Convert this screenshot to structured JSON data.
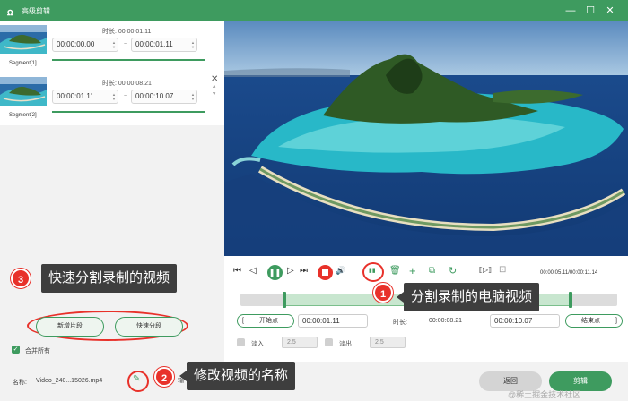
{
  "window": {
    "title": "高级剪辑",
    "logo_glyph": "ꭥ",
    "accent_color": "#3e9b5f",
    "controls": {
      "minimize": "—",
      "maximize": "☐",
      "close": "✕"
    }
  },
  "segments": [
    {
      "label": "Segment[1]",
      "duration_label": "时长: 00:00:01.11",
      "start": "00:00:00.00",
      "end": "00:00:01.11"
    },
    {
      "label": "Segment[2]",
      "duration_label": "时长: 00:00:08.21",
      "start": "00:00:01.11",
      "end": "00:00:10.07"
    }
  ],
  "segment_controls": {
    "close_glyph": "✕",
    "up_glyph": "˄",
    "down_glyph": "˅",
    "spin_up": "▲",
    "spin_down": "▼",
    "range_sep": "~"
  },
  "left_actions": {
    "new_segment": "新增片段",
    "quick_split": "快速分段",
    "merge_all": "合并所有",
    "check_glyph": "✓"
  },
  "output": {
    "name_label": "名称:",
    "filename": "Video_240...15026.mp4",
    "output_label_partial": "输"
  },
  "callouts": [
    {
      "number": "3",
      "text": "快速分割录制的视频"
    },
    {
      "number": "1",
      "text": "分割录制的电脑视频"
    },
    {
      "number": "2",
      "text": "修改视频的名称"
    }
  ],
  "player": {
    "time_display": "00:00:05.11/00:00:11.14",
    "icons": {
      "prev_frame": "⏮",
      "step_back": "◁",
      "play_pause": "❚❚",
      "step_forward": "▷",
      "next_frame": "⏭",
      "volume": "🔊",
      "split": "▮▮",
      "delete": "🗑",
      "add": "+",
      "copy": "⧉",
      "reset": "↻",
      "crop": "⟦▷⟧",
      "fit": "⊡"
    }
  },
  "clip": {
    "start_button": "开始点",
    "start_time": "00:00:01.11",
    "duration_label": "时长:",
    "duration_value": "00:00:08.21",
    "end_time": "00:00:10.07",
    "end_button": "结束点",
    "bracket_open": "[",
    "bracket_close": "]",
    "fade_in_label": "淡入",
    "fade_in_value": "2.5",
    "fade_out_label": "淡出",
    "fade_out_value": "2.5"
  },
  "bottom": {
    "back_button": "返回",
    "cut_button": "剪辑"
  },
  "watermark": "@稀土掘金技术社区"
}
